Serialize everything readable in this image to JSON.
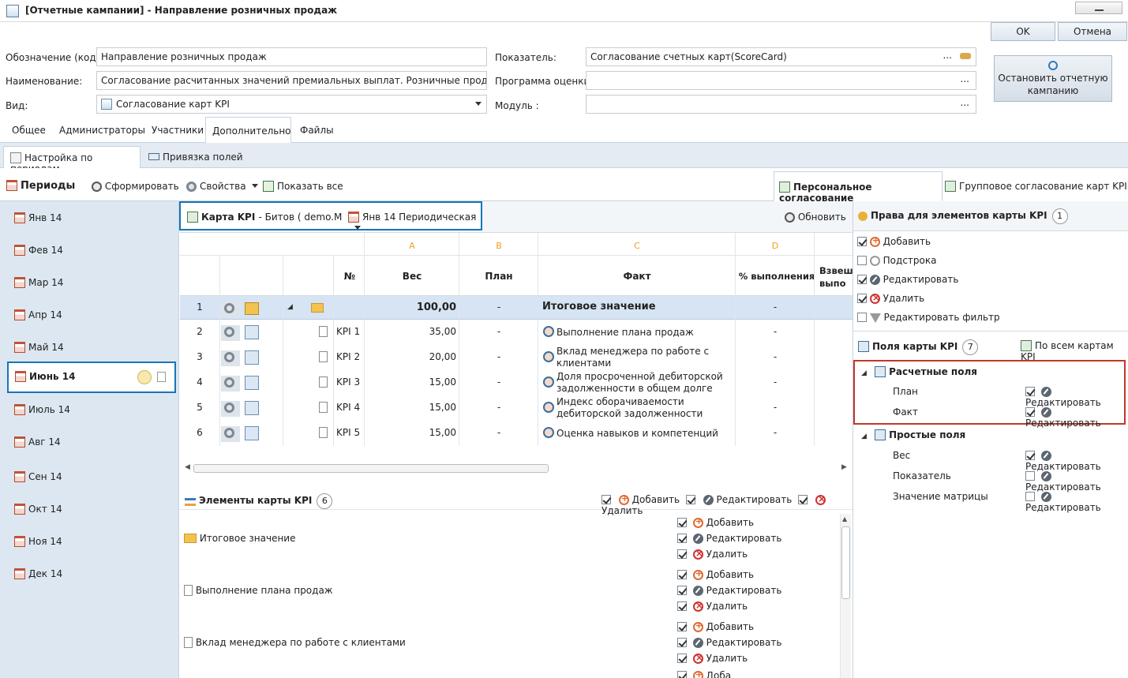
{
  "window": {
    "title": "[Отчетные кампании] - Направление розничных продаж"
  },
  "actions": {
    "ok": "OK",
    "cancel": "Отмена",
    "stop": "Остановить отчетную кампанию"
  },
  "form": {
    "code_label": "Обозначение (код):",
    "code_value": "Направление розничных продаж",
    "name_label": "Наименование:",
    "name_value": "Согласование расчитанных значений премиальных выплат. Розничные продажи",
    "type_label": "Вид:",
    "type_value": "Согласование карт KPI",
    "indicator_label": "Показатель:",
    "indicator_value": "Согласование счетных карт(ScoreCard)",
    "program_label": "Программа оценки :",
    "program_value": "",
    "module_label": "Модуль :",
    "module_value": "",
    "dots": "..."
  },
  "tabs": [
    "Общее",
    "Администраторы",
    "Участники",
    "Дополнительно",
    "Файлы"
  ],
  "subtabs": [
    "Настройка по периодам",
    "Привязка полей"
  ],
  "periods": {
    "title": "Периоды",
    "generate": "Сформировать",
    "items": [
      "Янв 14",
      "Фев 14",
      "Мар 14",
      "Апр 14",
      "Май 14",
      "Июнь 14",
      "Июль 14",
      "Авг 14",
      "Сен 14",
      "Окт 14",
      "Ноя 14",
      "Дек 14"
    ],
    "selected": "Июнь 14"
  },
  "toolbar": {
    "properties": "Свойства",
    "show_all": "Показать все",
    "refresh": "Обновить"
  },
  "approval_tabs": {
    "personal": "Персональное согласование",
    "group": "Групповое согласование карт KPI"
  },
  "card": {
    "label": "Карта KPI",
    "value": "- Битов ( demo.M",
    "period": "Янв 14  Периодическая"
  },
  "grid": {
    "letters": [
      "A",
      "B",
      "C",
      "D"
    ],
    "headers": {
      "num": "№",
      "weight": "Вес",
      "plan": "План",
      "fact": "Факт",
      "pct": "% выполнения",
      "weighted": "Взвеш выпо"
    },
    "rows": [
      {
        "idx": "1",
        "kpi": "",
        "weight": "100,00",
        "plan": "-",
        "fact": "Итоговое значение",
        "pct": "-"
      },
      {
        "idx": "2",
        "kpi": "KPI 1",
        "weight": "35,00",
        "plan": "-",
        "fact": "Выполнение плана продаж",
        "pct": "-"
      },
      {
        "idx": "3",
        "kpi": "KPI 2",
        "weight": "20,00",
        "plan": "-",
        "fact": "Вклад менеджера по работе с клиентами",
        "pct": "-"
      },
      {
        "idx": "4",
        "kpi": "KPI 3",
        "weight": "15,00",
        "plan": "-",
        "fact": "Доля просроченной дебиторской задолженности в общем долге",
        "pct": "-"
      },
      {
        "idx": "5",
        "kpi": "KPI 4",
        "weight": "15,00",
        "plan": "-",
        "fact": "Индекс оборачиваемости дебиторской задолженности",
        "pct": "-"
      },
      {
        "idx": "6",
        "kpi": "KPI 5",
        "weight": "15,00",
        "plan": "-",
        "fact": "Оценка навыков и компетенций",
        "pct": "-"
      }
    ]
  },
  "elements": {
    "title": "Элементы карты KPI",
    "count": "6",
    "add": "Добавить",
    "edit": "Редактировать",
    "delete": "Удалить",
    "items": [
      "Итоговое значение",
      "Выполнение плана продаж",
      "Вклад менеджера по работе с клиентами"
    ],
    "partial": "Доба"
  },
  "rights": {
    "title": "Права для элементов карты KPI",
    "count": "1",
    "items": [
      {
        "label": "Добавить",
        "checked": true
      },
      {
        "label": "Подстрока",
        "checked": false
      },
      {
        "label": "Редактировать",
        "checked": true
      },
      {
        "label": "Удалить",
        "checked": true
      },
      {
        "label": "Редактировать фильтр",
        "checked": false
      }
    ]
  },
  "fields": {
    "title": "Поля карты KPI",
    "count": "7",
    "all_cards": "По всем картам KPI",
    "calc_group": "Расчетные поля",
    "calc_items": [
      {
        "label": "План",
        "checked": true
      },
      {
        "label": "Факт",
        "checked": true
      }
    ],
    "simple_group": "Простые поля",
    "simple_items": [
      {
        "label": "Вес",
        "checked": true
      },
      {
        "label": "Показатель",
        "checked": false
      },
      {
        "label": "Значение матрицы",
        "checked": false
      }
    ],
    "edit": "Редактировать"
  }
}
